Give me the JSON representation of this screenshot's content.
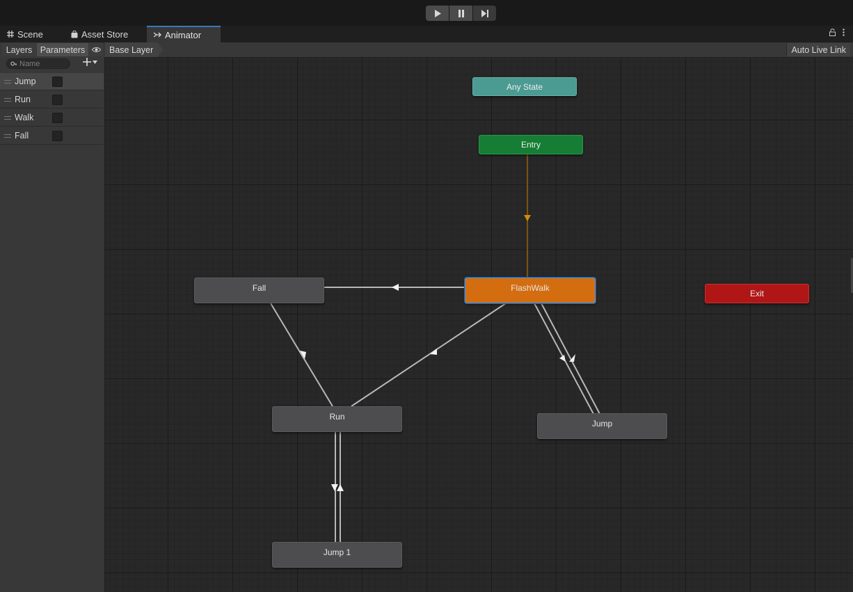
{
  "toolbar": {
    "play_icon": "play-icon",
    "pause_icon": "pause-icon",
    "step_icon": "step-icon"
  },
  "tabs": [
    {
      "label": "Scene",
      "icon": "grid-icon"
    },
    {
      "label": "Asset Store",
      "icon": "bag-icon"
    },
    {
      "label": "Animator",
      "icon": "animator-icon",
      "active": true
    }
  ],
  "subbar": {
    "layers_label": "Layers",
    "parameters_label": "Parameters",
    "breadcrumb": "Base Layer",
    "auto_live_link": "Auto Live Link"
  },
  "search": {
    "placeholder": "Name"
  },
  "parameters": [
    {
      "name": "Jump",
      "type": "bool",
      "value": false,
      "selected": true
    },
    {
      "name": "Run",
      "type": "bool",
      "value": false
    },
    {
      "name": "Walk",
      "type": "bool",
      "value": false
    },
    {
      "name": "Fall",
      "type": "bool",
      "value": false
    }
  ],
  "states": {
    "any_state": "Any State",
    "entry": "Entry",
    "exit": "Exit",
    "flashwalk": "FlashWalk",
    "fall": "Fall",
    "run": "Run",
    "jump": "Jump",
    "jump1": "Jump 1"
  },
  "transitions": [
    {
      "from": "Entry",
      "to": "FlashWalk",
      "default": true
    },
    {
      "from": "FlashWalk",
      "to": "Fall"
    },
    {
      "from": "FlashWalk",
      "to": "Run"
    },
    {
      "from": "Run",
      "to": "Fall"
    },
    {
      "from": "FlashWalk",
      "to": "Jump"
    },
    {
      "from": "Jump",
      "to": "FlashWalk"
    },
    {
      "from": "Run",
      "to": "Jump 1"
    },
    {
      "from": "Jump 1",
      "to": "Run"
    }
  ],
  "colors": {
    "accent_tab": "#3a79bb",
    "default_state": "#d36d0f",
    "entry_state": "#167d35",
    "any_state": "#4b9b92",
    "exit_state": "#b11616",
    "default_transition": "#8a5a0c"
  }
}
